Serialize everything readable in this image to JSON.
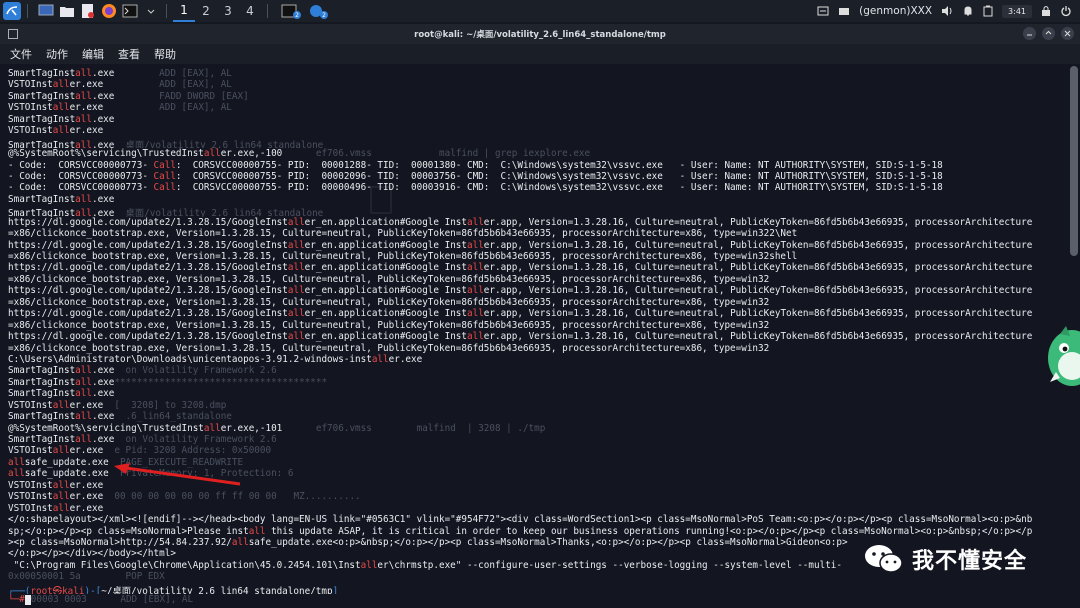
{
  "panel": {
    "workspaces": [
      "1",
      "2",
      "3",
      "4"
    ],
    "active_workspace": "1",
    "badge_1": "2",
    "badge_2": "2",
    "genmon": "(genmon)XXX",
    "clock": "3:41"
  },
  "window": {
    "title": "root@kali: ~/桌面/volatility_2.6_lin64_standalone/tmp"
  },
  "menu": [
    "文件",
    "动作",
    "编辑",
    "查看",
    "帮助"
  ],
  "terminal": {
    "lines": [
      [
        {
          "t": "SmartTagInst"
        },
        {
          "t": "all",
          "c": "hl"
        },
        {
          "t": ".exe"
        },
        {
          "t": "        ADD [EAX], AL",
          "c": "ghost"
        }
      ],
      [
        {
          "t": "VSTOInst"
        },
        {
          "t": "all",
          "c": "hl"
        },
        {
          "t": "er.exe"
        },
        {
          "t": "          ADD [EAX], AL",
          "c": "ghost"
        }
      ],
      [
        {
          "t": "SmartTagInst"
        },
        {
          "t": "all",
          "c": "hl"
        },
        {
          "t": ".exe"
        },
        {
          "t": "        FADD DWORD [EAX]",
          "c": "ghost"
        }
      ],
      [
        {
          "t": "VSTOInst"
        },
        {
          "t": "all",
          "c": "hl"
        },
        {
          "t": "er.exe"
        },
        {
          "t": "          ADD [EAX], AL",
          "c": "ghost"
        }
      ],
      [
        {
          "t": "SmartTagInst"
        },
        {
          "t": "all",
          "c": "hl"
        },
        {
          "t": ".exe"
        }
      ],
      [
        {
          "t": "VSTOInst"
        },
        {
          "t": "all",
          "c": "hl"
        },
        {
          "t": "er.exe"
        }
      ],
      [
        {
          "t": "SmartTagInst"
        },
        {
          "t": "all",
          "c": "hl"
        },
        {
          "t": ".exe"
        },
        {
          "t": "  桌面/volatility_2.6_lin64_standalone",
          "c": "ghost"
        }
      ],
      [
        {
          "t": "@%SystemRoot%\\servicing\\TrustedInst"
        },
        {
          "t": "all",
          "c": "hl"
        },
        {
          "t": "er.exe,-100"
        },
        {
          "t": "      ef706.vmss            malfind | grep iexplore.exe",
          "c": "ghost"
        }
      ],
      [
        {
          "t": "- Code:  CORSVCC00000773- "
        },
        {
          "t": "Call",
          "c": "hl"
        },
        {
          "t": ":  CORSVCC00000755- PID:  00001288- TID:  00001380- CMD:  C:\\Windows\\system32\\vssvc.exe   - User: Name: NT AUTHORITY\\SYSTEM, SID:S-1-5-18"
        }
      ],
      [
        {
          "t": "- Code:  CORSVCC00000773- "
        },
        {
          "t": "Call",
          "c": "hl"
        },
        {
          "t": ":  CORSVCC00000755- PID:  00002096- TID:  00003756- CMD:  C:\\Windows\\system32\\vssvc.exe   - User: Name: NT AUTHORITY\\SYSTEM, SID:S-1-5-18"
        }
      ],
      [
        {
          "t": "- Code:  CORSVCC00000773- "
        },
        {
          "t": "Call",
          "c": "hl"
        },
        {
          "t": ":  CORSVCC00000755- PID:  00000496- TID:  00003916- CMD:  C:\\Windows\\system32\\vssvc.exe   - User: Name: NT AUTHORITY\\SYSTEM, SID:S-1-5-18"
        }
      ],
      [
        {
          "t": "SmartTagInst"
        },
        {
          "t": "all",
          "c": "hl"
        },
        {
          "t": ".exe"
        }
      ],
      [
        {
          "t": "SmartTagInst"
        },
        {
          "t": "all",
          "c": "hl"
        },
        {
          "t": ".exe"
        },
        {
          "t": "  桌面/volatility_2.6_lin64_standalone",
          "c": "ghost"
        }
      ],
      [
        {
          "t": "https://dl.google.com/update2/1.3.28.15/GoogleInst"
        },
        {
          "t": "all",
          "c": "hl"
        },
        {
          "t": "er_en.application#Google Inst"
        },
        {
          "t": "all",
          "c": "hl"
        },
        {
          "t": "er.app, Version=1.3.28.16, Culture=neutral, PublicKeyToken=86fd5b6b43e66935, processorArchitecture"
        }
      ],
      [
        {
          "t": "=x86/clickonce_bootstrap.exe, Version=1.3.28.15, Culture=neutral, PublicKeyToken=86fd5b6b43e66935, processorArchitecture=x86, type=win322\\Net"
        }
      ],
      [
        {
          "t": "https://dl.google.com/update2/1.3.28.15/GoogleInst"
        },
        {
          "t": "all",
          "c": "hl"
        },
        {
          "t": "er_en.application#Google Inst"
        },
        {
          "t": "all",
          "c": "hl"
        },
        {
          "t": "er.app, Version=1.3.28.16, Culture=neutral, PublicKeyToken=86fd5b6b43e66935, processorArchitecture"
        }
      ],
      [
        {
          "t": "=x86/clickonce_bootstrap.exe, Version=1.3.28.15, Culture=neutral, PublicKeyToken=86fd5b6b43e66935, processorArchitecture=x86, type=win32shell"
        }
      ],
      [
        {
          "t": "https://dl.google.com/update2/1.3.28.15/GoogleInst"
        },
        {
          "t": "all",
          "c": "hl"
        },
        {
          "t": "er_en.application#Google Inst"
        },
        {
          "t": "all",
          "c": "hl"
        },
        {
          "t": "er.app, Version=1.3.28.16, Culture=neutral, PublicKeyToken=86fd5b6b43e66935, processorArchitecture"
        }
      ],
      [
        {
          "t": "=x86/clickonce_bootstrap.exe, Version=1.3.28.15, Culture=neutral, PublicKeyToken=86fd5b6b43e66935, processorArchitecture=x86, type=win32"
        }
      ],
      [
        {
          "t": "https://dl.google.com/update2/1.3.28.15/GoogleInst"
        },
        {
          "t": "all",
          "c": "hl"
        },
        {
          "t": "er_en.application#Google Inst"
        },
        {
          "t": "all",
          "c": "hl"
        },
        {
          "t": "er.app, Version=1.3.28.16, Culture=neutral, PublicKeyToken=86fd5b6b43e66935, processorArchitecture"
        }
      ],
      [
        {
          "t": "=x86/clickonce_bootstrap.exe, Version=1.3.28.15, Culture=neutral, PublicKeyToken=86fd5b6b43e66935, processorArchitecture=x86, type=win32"
        }
      ],
      [
        {
          "t": "https://dl.google.com/update2/1.3.28.15/GoogleInst"
        },
        {
          "t": "all",
          "c": "hl"
        },
        {
          "t": "er_en.application#Google Inst"
        },
        {
          "t": "all",
          "c": "hl"
        },
        {
          "t": "er.app, Version=1.3.28.16, Culture=neutral, PublicKeyToken=86fd5b6b43e66935, processorArchitecture"
        }
      ],
      [
        {
          "t": "=x86/clickonce_bootstrap.exe, Version=1.3.28.15, Culture=neutral, PublicKeyToken=86fd5b6b43e66935, processorArchitecture=x86, type=win32"
        }
      ],
      [
        {
          "t": "https://dl.google.com/update2/1.3.28.15/GoogleInst"
        },
        {
          "t": "all",
          "c": "hl"
        },
        {
          "t": "er_en.application#Google Inst"
        },
        {
          "t": "all",
          "c": "hl"
        },
        {
          "t": "er.app, Version=1.3.28.16, Culture=neutral, PublicKeyToken=86fd5b6b43e66935, processorArchitecture"
        }
      ],
      [
        {
          "t": "=x86/clickonce_bootstrap.exe, Version=1.3.28.15, Culture=neutral, PublicKeyToken=86fd5b6b43e66935, processorArchitecture=x86, type=win32"
        }
      ],
      [
        {
          "t": "C:\\Users\\Administrator\\Downloads\\unicentaopos-3.91.2-windows-inst"
        },
        {
          "t": "all",
          "c": "hl"
        },
        {
          "t": "er.exe"
        }
      ],
      [
        {
          "t": "SmartTagInst"
        },
        {
          "t": "all",
          "c": "hl"
        },
        {
          "t": ".exe"
        },
        {
          "t": "  on Volatility Framework 2.6",
          "c": "ghost"
        }
      ],
      [
        {
          "t": "SmartTagInst"
        },
        {
          "t": "all",
          "c": "hl"
        },
        {
          "t": ".exe"
        },
        {
          "t": "**************************************",
          "c": "ghost"
        }
      ],
      [
        {
          "t": "SmartTagInst"
        },
        {
          "t": "all",
          "c": "hl"
        },
        {
          "t": ".exe"
        }
      ],
      [
        {
          "t": "VSTOInst"
        },
        {
          "t": "all",
          "c": "hl"
        },
        {
          "t": "er.exe"
        },
        {
          "t": "  [  3208] to 3208.dmp",
          "c": "ghost"
        }
      ],
      [
        {
          "t": "SmartTagInst"
        },
        {
          "t": "all",
          "c": "hl"
        },
        {
          "t": ".exe"
        },
        {
          "t": "  .6_lin64_standalone",
          "c": "ghost"
        }
      ],
      [
        {
          "t": "@%SystemRoot%\\servicing\\TrustedInst"
        },
        {
          "t": "all",
          "c": "hl"
        },
        {
          "t": "er.exe,-101"
        },
        {
          "t": "      ef706.vmss        malfind  | 3208 | ./tmp",
          "c": "ghost"
        }
      ],
      [
        {
          "t": "SmartTagInst"
        },
        {
          "t": "all",
          "c": "hl"
        },
        {
          "t": ".exe"
        },
        {
          "t": "  on Volatility Framework 2.6",
          "c": "ghost"
        }
      ],
      [
        {
          "t": "VSTOInst"
        },
        {
          "t": "all",
          "c": "hl"
        },
        {
          "t": "er.exe"
        },
        {
          "t": "  e Pid: 3208 Address: 0x50000",
          "c": "ghost"
        }
      ],
      [
        {
          "t": "all",
          "c": "hl"
        },
        {
          "t": "safe_update.exe"
        },
        {
          "t": "  PAGE_EXECUTE_READWRITE",
          "c": "ghost"
        }
      ],
      [
        {
          "t": "all",
          "c": "hl"
        },
        {
          "t": "safe_update.exe"
        },
        {
          "t": "  PrivateMemory: 1, Protection: 6",
          "c": "ghost"
        }
      ],
      [
        {
          "t": "VSTOInst"
        },
        {
          "t": "all",
          "c": "hl"
        },
        {
          "t": "er.exe"
        }
      ],
      [
        {
          "t": "VSTOInst"
        },
        {
          "t": "all",
          "c": "hl"
        },
        {
          "t": "er.exe"
        },
        {
          "t": "  00 00 00 00 00 00 ff ff 00 00   MZ..........",
          "c": "ghost"
        }
      ],
      [
        {
          "t": "VSTOInst"
        },
        {
          "t": "all",
          "c": "hl"
        },
        {
          "t": "er.exe"
        }
      ],
      [
        {
          "t": "</o:shapelayout></xml><![endif]--></head><body lang=EN-US link=\"#0563C1\" vlink=\"#954F72\"><div class=WordSection1><p class=MsoNormal>PoS Team:<o:p></o:p></p><p class=MsoNormal><o:p>&nb"
        }
      ],
      [
        {
          "t": "sp;</o:p></p><p class=MsoNormal>Please inst"
        },
        {
          "t": "all",
          "c": "hl"
        },
        {
          "t": " this update ASAP, it is critical in order to keep our business operations running!<o:p></o:p></p><p class=MsoNormal><o:p>&nbsp;</o:p></p"
        }
      ],
      [
        {
          "t": "><p class=MsoNormal>http://54.84.237.92/"
        },
        {
          "t": "all",
          "c": "hl"
        },
        {
          "t": "safe_update.exe<o:p>&nbsp;</o:p></p><p class=MsoNormal>Thanks,<o:p></o:p></p><p class=MsoNormal>Gideon<o:p>"
        }
      ],
      [
        {
          "t": "</o:p></p></div></body></html>"
        }
      ],
      [
        {
          "t": " \"C:\\Program Files\\Google\\Chrome\\Application\\45.0.2454.101\\Inst"
        },
        {
          "t": "all",
          "c": "hl"
        },
        {
          "t": "er\\chrmstp.exe\" --configure-user-settings --verbose-logging --system-level --multi-"
        }
      ],
      [
        {
          "t": "0x00050001 5a        POP EDX",
          "c": "ghost"
        }
      ],
      [
        {
          "t": "┌──(",
          "c": "prompt"
        },
        {
          "t": "root㉿kali",
          "c": "user"
        },
        {
          "t": ")-[",
          "c": "prompt"
        },
        {
          "t": "~/桌面/volatility_2.6_lin64_standalone/tmp"
        },
        {
          "t": "]",
          "c": "prompt"
        }
      ],
      [
        {
          "t": "└─#",
          "c": "user"
        },
        {
          "t": " ",
          "c": "cursor"
        },
        {
          "t": "00003 0003      ADD [EBX], AL",
          "c": "ghost"
        }
      ]
    ]
  },
  "watermark": {
    "text": "我不懂安全"
  },
  "colors": {
    "highlight": "#e84a4a",
    "prompt": "#3b8de0",
    "background": "#131620"
  }
}
